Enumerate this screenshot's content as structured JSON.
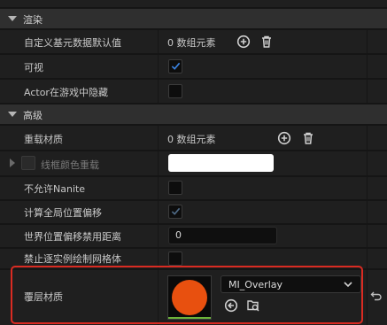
{
  "rendering": {
    "header": "渲染",
    "rows": [
      {
        "label": "自定义基元数据默认值",
        "value": "0 数组元素"
      },
      {
        "label": "可视"
      },
      {
        "label": "Actor在游戏中隐藏"
      }
    ]
  },
  "advanced": {
    "header": "高级",
    "rows": [
      {
        "label": "重载材质",
        "value": "0 数组元素"
      },
      {
        "label": "线框颜色重载"
      },
      {
        "label": "不允许Nanite"
      },
      {
        "label": "计算全局位置偏移"
      },
      {
        "label": "世界位置偏移禁用距离",
        "value": "0"
      },
      {
        "label": "禁止逐实例绘制网格体"
      },
      {
        "label": "覆层材质",
        "value": "MI_Overlay"
      }
    ]
  },
  "colors": {
    "accent": "#3a82e0",
    "material_thumbnail": "#e8500f",
    "highlight": "#d92b22"
  }
}
